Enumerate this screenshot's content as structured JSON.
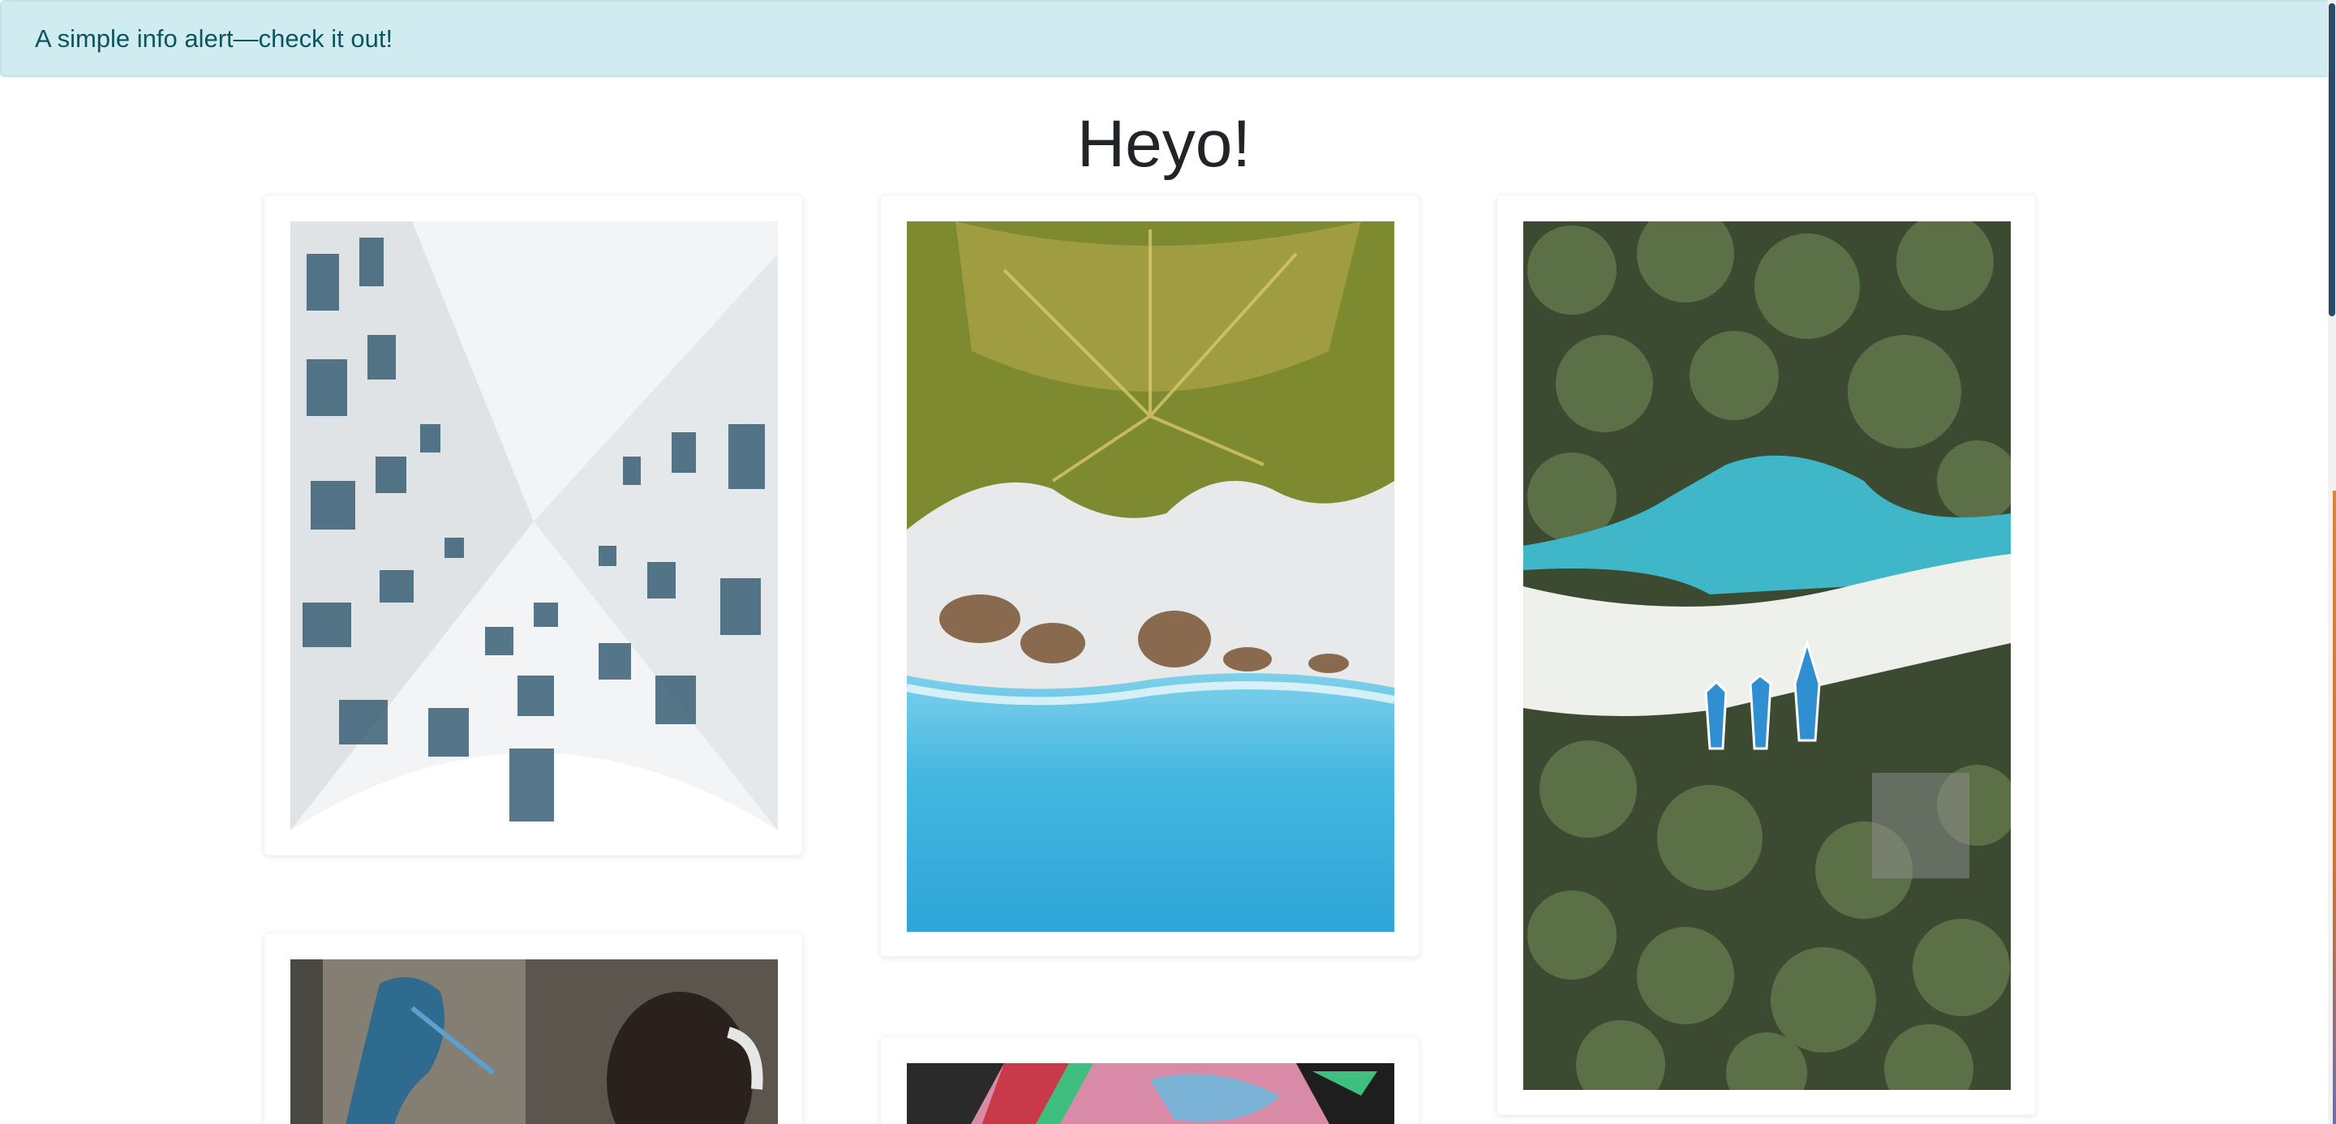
{
  "alert": {
    "text": "A simple info alert—check it out!"
  },
  "page": {
    "title": "Heyo!"
  },
  "gallery": {
    "images": [
      {
        "subject": "Low-angle view of white apartment buildings"
      },
      {
        "subject": "Aerial view of palm trees, white sand and turquoise sea"
      },
      {
        "subject": "Aerial view of palm forest, lagoon and blue boats on a beach"
      },
      {
        "subject": "Graffiti wall with a person in headphones"
      },
      {
        "subject": "Colorful graffiti wall"
      }
    ]
  }
}
